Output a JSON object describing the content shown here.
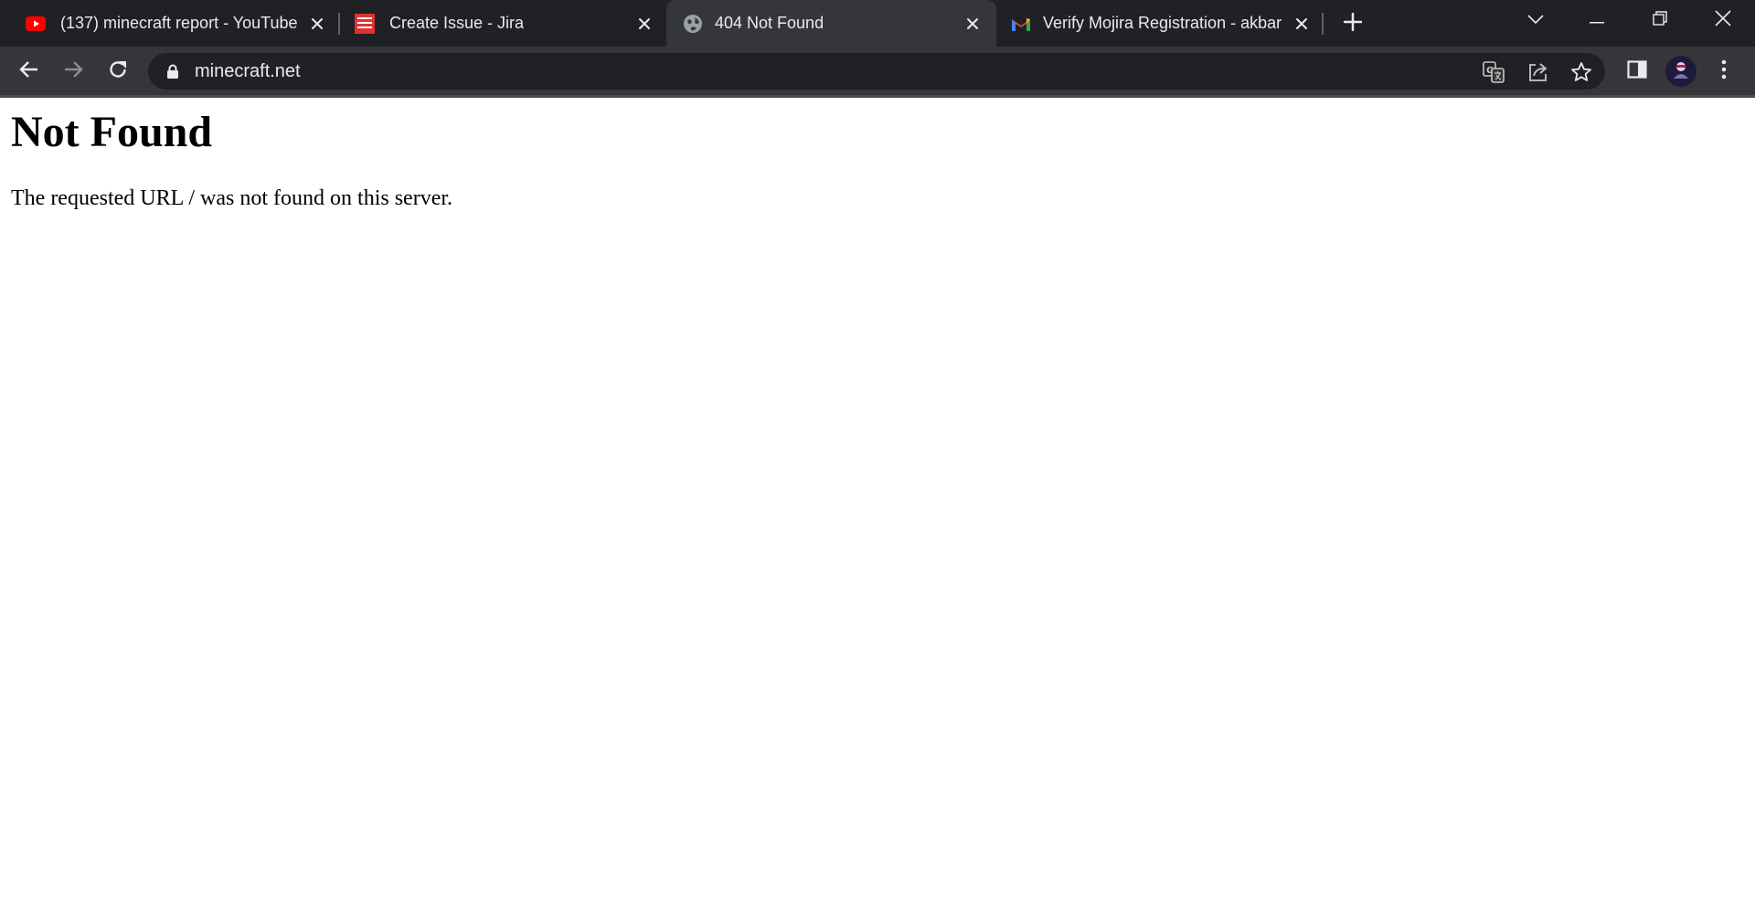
{
  "browser": {
    "tabs": [
      {
        "title": "(137) minecraft report - YouTube",
        "favicon": "youtube-icon",
        "active": false
      },
      {
        "title": "Create Issue - Jira",
        "favicon": "mojira-icon",
        "active": false
      },
      {
        "title": "404 Not Found",
        "favicon": "globe-icon",
        "active": true
      },
      {
        "title": "Verify Mojira Registration - akbar",
        "favicon": "gmail-icon",
        "active": false
      }
    ],
    "new_tab_icon": "plus-icon",
    "tab_search_icon": "chevron-down-icon",
    "window_controls": [
      "minimize-icon",
      "restore-icon",
      "close-icon"
    ]
  },
  "toolbar": {
    "back_icon": "arrow-left-icon",
    "forward_icon": "arrow-right-icon",
    "reload_icon": "reload-icon",
    "url": "minecraft.net",
    "lock_icon": "lock-icon",
    "omnibox_icons": [
      "translate-icon",
      "share-icon",
      "star-icon"
    ],
    "side_panel_icon": "side-panel-icon",
    "menu_icon": "kebab-menu-icon"
  },
  "page": {
    "heading": "Not Found",
    "message": "The requested URL / was not found on this server."
  },
  "colors": {
    "tabstrip_bg": "#202124",
    "active_tab_bg": "#35363a",
    "omnibox_bg": "#202124",
    "text_light": "#e8eaed",
    "page_bg": "#ffffff"
  }
}
